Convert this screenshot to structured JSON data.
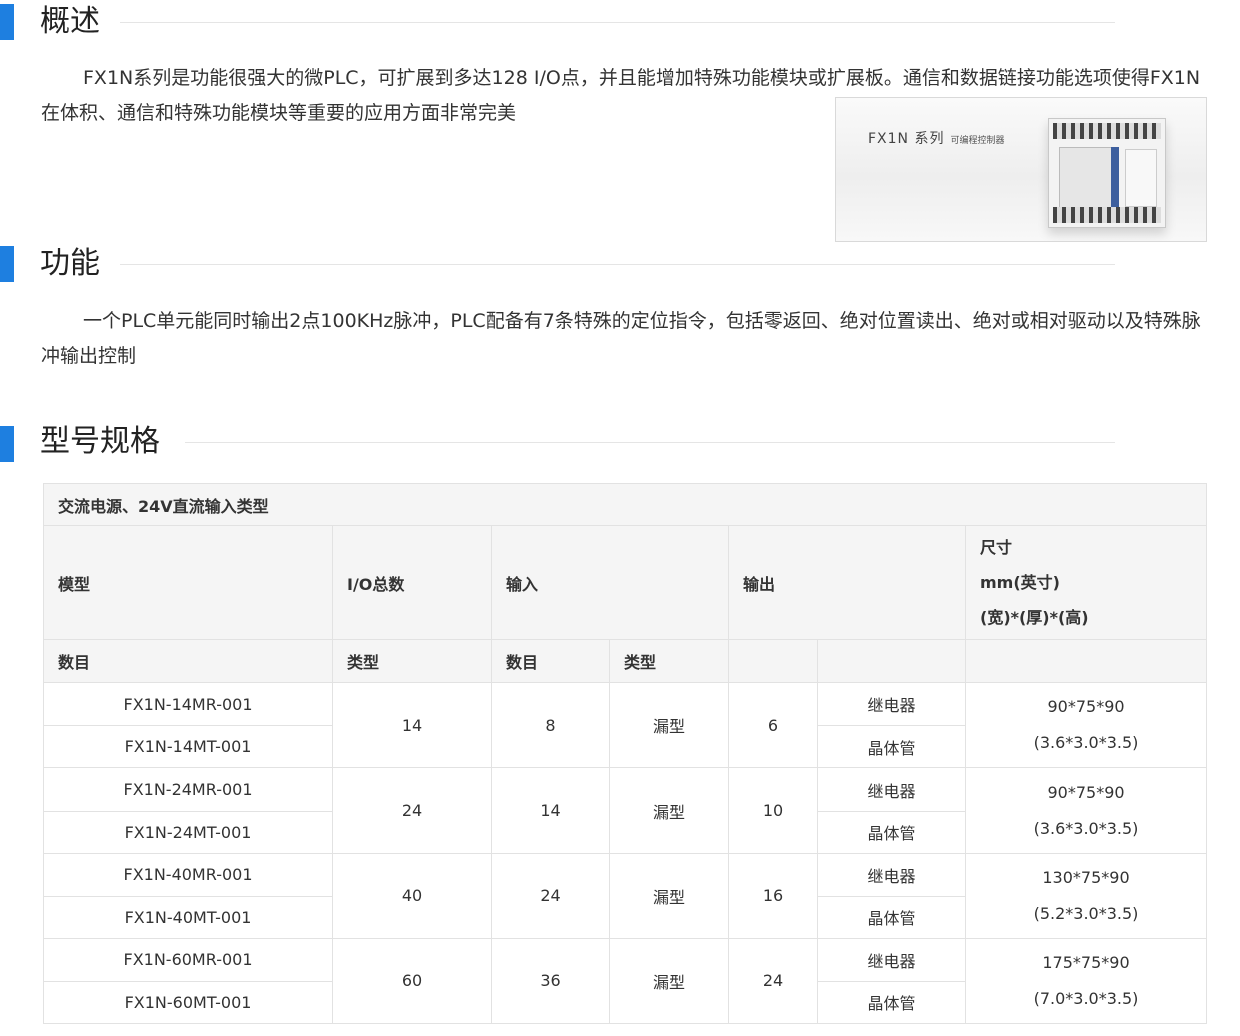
{
  "sections": {
    "overview": {
      "title": "概述",
      "text": "FX1N系列是功能很强大的微PLC，可扩展到多达128 I/O点，并且能增加特殊功能模块或扩展板。通信和数据链接功能选项使得FX1N在体积、通信和特殊功能模块等重要的应用方面非常完美",
      "image_caption": "FX1N 系列",
      "image_caption_small": "可编程控制器"
    },
    "functions": {
      "title": "功能",
      "text": "一个PLC单元能同时输出2点100KHz脉冲，PLC配备有7条特殊的定位指令，包括零返回、绝对位置读出、绝对或相对驱动以及特殊脉冲输出控制"
    },
    "specs": {
      "title": "型号规格",
      "caption": "交流电源、24V直流输入类型",
      "headers": {
        "model": "模型",
        "io_total": "I/O总数",
        "input": "输入",
        "output": "输出",
        "size_line1": "尺寸",
        "size_line2": "mm(英寸)",
        "size_line3": "(宽)*(厚)*(高)"
      },
      "subheaders": {
        "count": "数目",
        "type": "类型",
        "input_count": "数目",
        "input_type": "类型"
      },
      "rows": [
        {
          "model_r": "FX1N-14MR-001",
          "model_t": "FX1N-14MT-001",
          "io": "14",
          "in_count": "8",
          "in_type": "漏型",
          "out_count": "6",
          "out_r": "继电器",
          "out_t": "晶体管",
          "size_mm": "90*75*90",
          "size_in": "(3.6*3.0*3.5)"
        },
        {
          "model_r": "FX1N-24MR-001",
          "model_t": "FX1N-24MT-001",
          "io": "24",
          "in_count": "14",
          "in_type": "漏型",
          "out_count": "10",
          "out_r": "继电器",
          "out_t": "晶体管",
          "size_mm": "90*75*90",
          "size_in": "(3.6*3.0*3.5)"
        },
        {
          "model_r": "FX1N-40MR-001",
          "model_t": "FX1N-40MT-001",
          "io": "40",
          "in_count": "24",
          "in_type": "漏型",
          "out_count": "16",
          "out_r": "继电器",
          "out_t": "晶体管",
          "size_mm": "130*75*90",
          "size_in": "(5.2*3.0*3.5)"
        },
        {
          "model_r": "FX1N-60MR-001",
          "model_t": "FX1N-60MT-001",
          "io": "60",
          "in_count": "36",
          "in_type": "漏型",
          "out_count": "24",
          "out_r": "继电器",
          "out_t": "晶体管",
          "size_mm": "175*75*90",
          "size_in": "(7.0*3.0*3.5)"
        }
      ]
    }
  },
  "colors": {
    "accent": "#1e7fe0",
    "header_bg": "#f5f5f5",
    "border": "#e2e2e2"
  }
}
